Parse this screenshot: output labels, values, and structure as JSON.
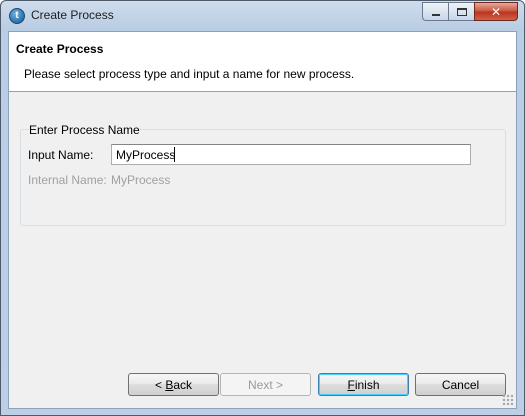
{
  "window": {
    "title": "Create Process",
    "app_icon": "talend-app-icon",
    "controls": {
      "minimize": "minimize-icon",
      "maximize": "maximize-icon",
      "close": "close-icon",
      "close_glyph": "✕"
    }
  },
  "header": {
    "title": "Create Process",
    "description": "Please select process type and input a name for new process."
  },
  "group": {
    "legend": "Enter Process Name",
    "input_label": "Input Name:",
    "input_value": "MyProcess",
    "internal_label": "Internal Name:",
    "internal_value": "MyProcess"
  },
  "buttons": {
    "back_mnemonic": "B",
    "back_rest": "ack",
    "back_prefix": "< ",
    "next": "Next >",
    "finish_mnemonic": "F",
    "finish_rest": "inish",
    "cancel": "Cancel"
  },
  "colors": {
    "accent_focus": "#48d1ff",
    "disabled_text": "#a0a0a0"
  }
}
